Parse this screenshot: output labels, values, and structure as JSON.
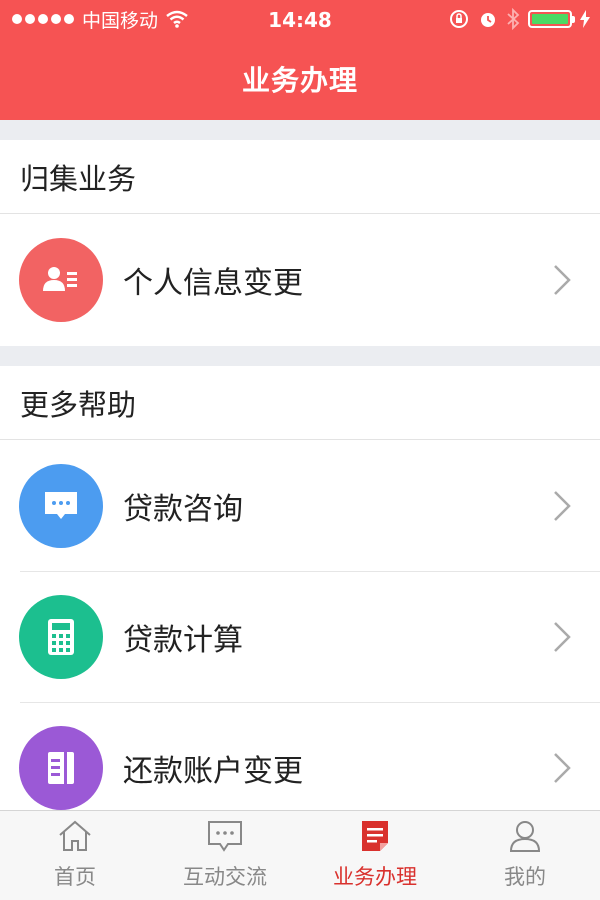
{
  "status_bar": {
    "carrier": "中国移动",
    "time": "14:48",
    "battery_level": 1.0
  },
  "header": {
    "title": "业务办理"
  },
  "sections": [
    {
      "title": "归集业务",
      "items": [
        {
          "label": "个人信息变更",
          "icon": "id-card-icon",
          "color": "#f26363"
        }
      ]
    },
    {
      "title": "更多帮助",
      "items": [
        {
          "label": "贷款咨询",
          "icon": "chat-bubble-icon",
          "color": "#4c9cf0"
        },
        {
          "label": "贷款计算",
          "icon": "calculator-icon",
          "color": "#1cbf8f"
        },
        {
          "label": "还款账户变更",
          "icon": "account-book-icon",
          "color": "#9b59d6"
        }
      ]
    }
  ],
  "tabbar": {
    "active": "业务办理",
    "active_color": "#d9312d",
    "tabs": [
      {
        "label": "首页",
        "icon": "home-icon"
      },
      {
        "label": "互动交流",
        "icon": "message-icon"
      },
      {
        "label": "业务办理",
        "icon": "document-icon"
      },
      {
        "label": "我的",
        "icon": "user-icon"
      }
    ]
  }
}
